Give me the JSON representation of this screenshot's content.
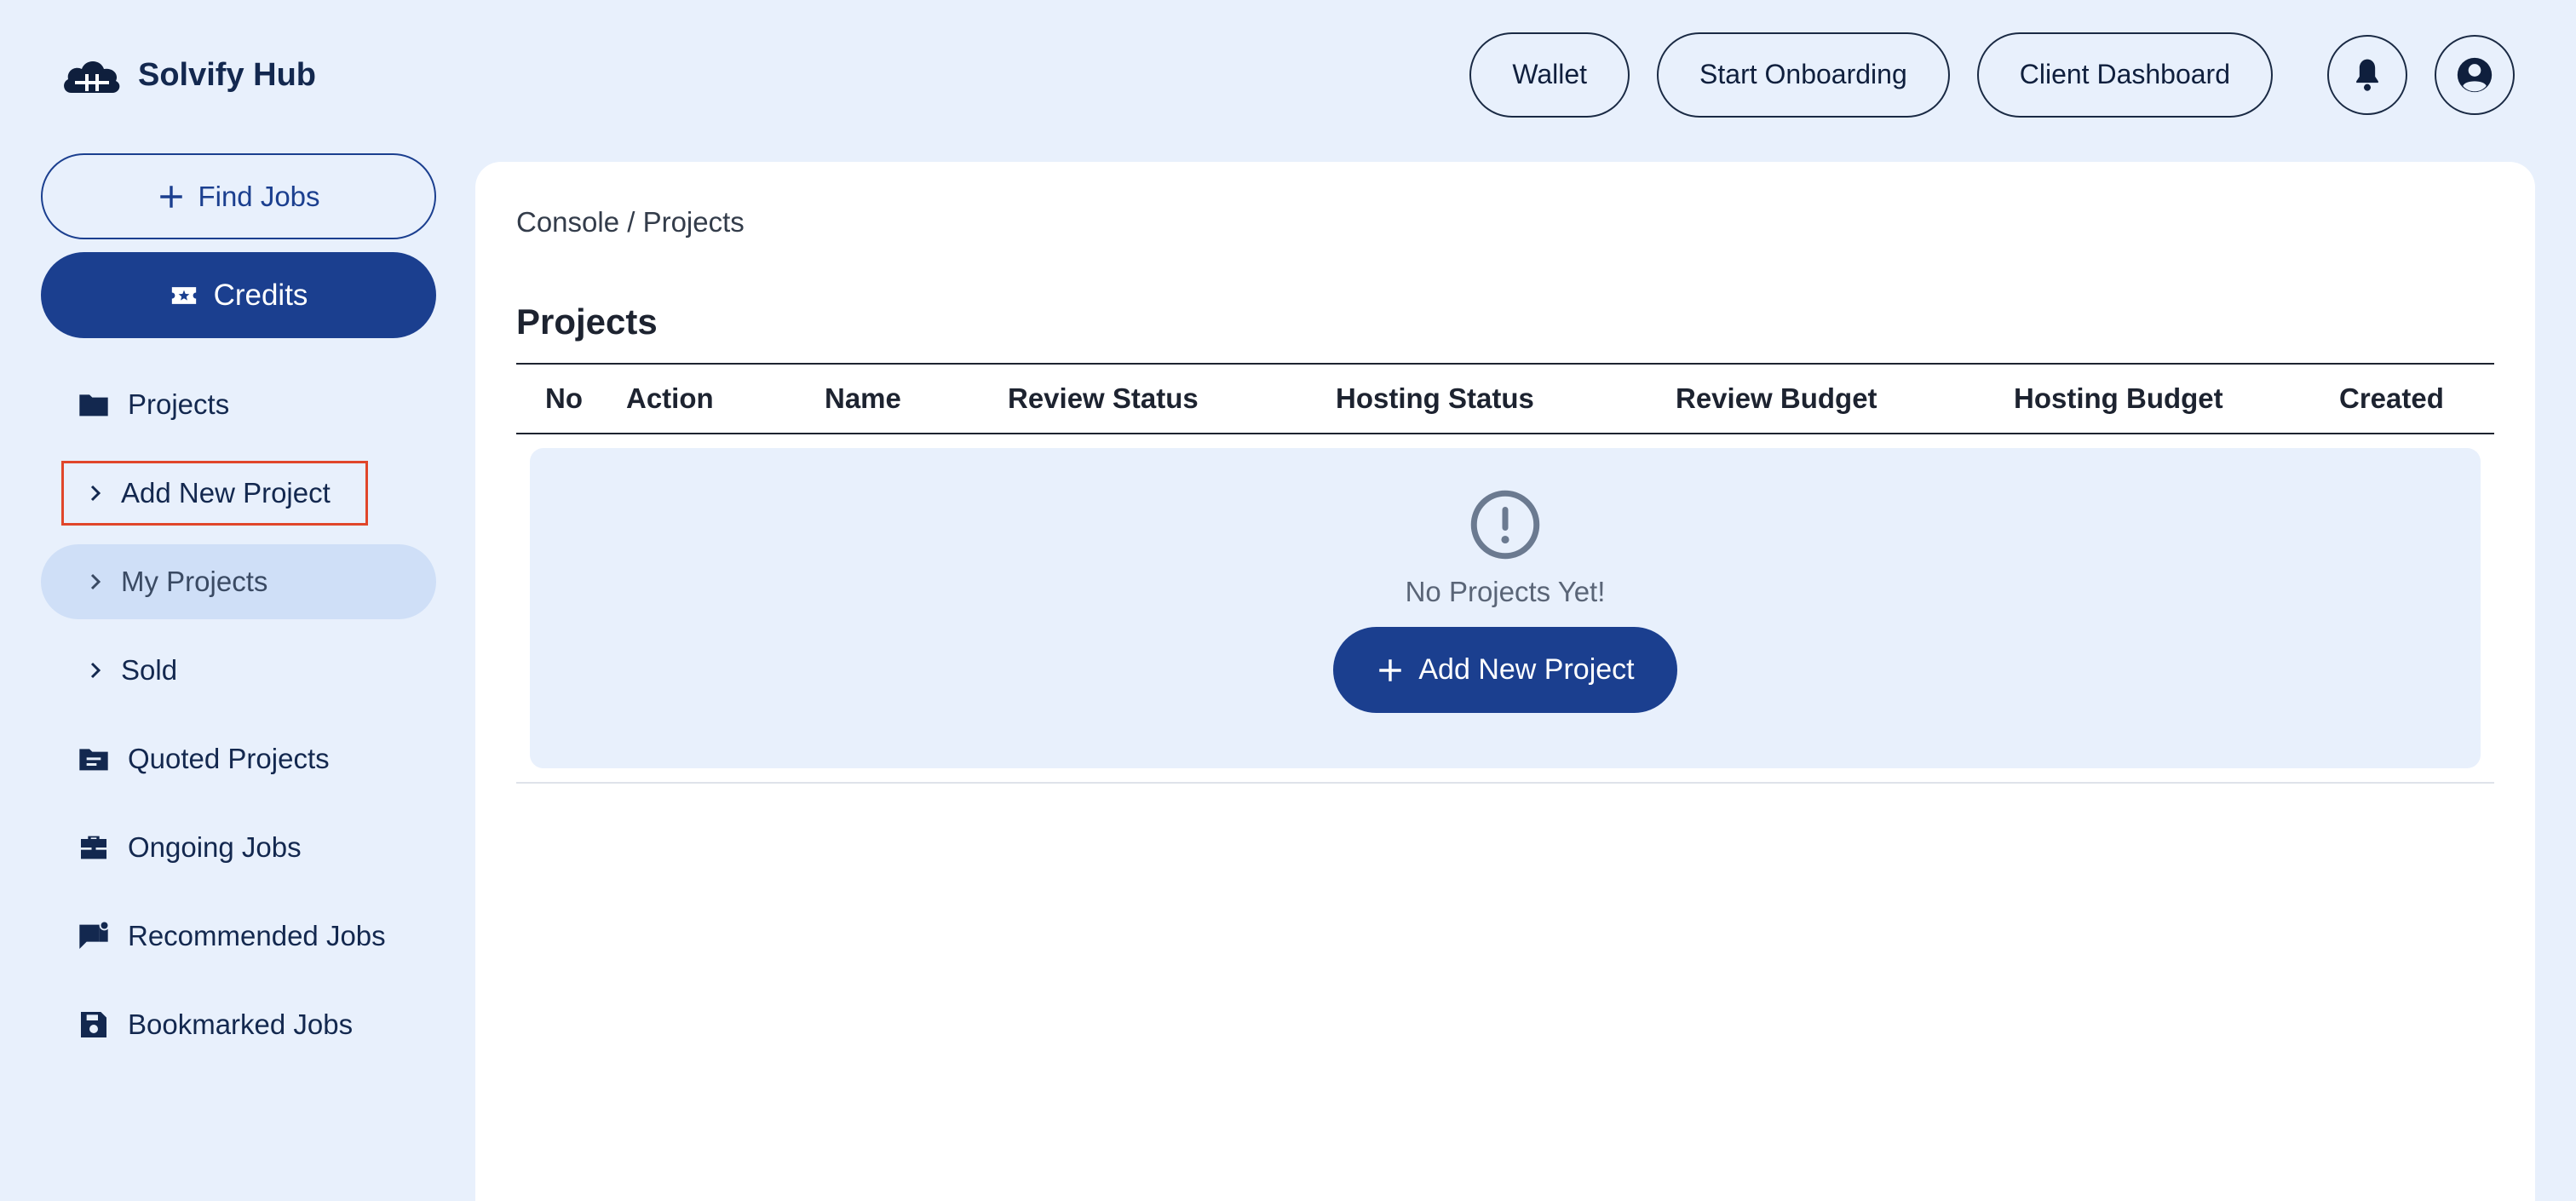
{
  "brand": {
    "name": "Solvify Hub",
    "icon": "cloud-icon"
  },
  "header": {
    "buttons": [
      "Wallet",
      "Start Onboarding",
      "Client Dashboard"
    ],
    "icons": [
      "bell-icon",
      "account-icon"
    ]
  },
  "sidebar": {
    "find_jobs": "Find Jobs",
    "credits": "Credits",
    "items": [
      {
        "label": "Projects",
        "icon": "folder-icon"
      },
      {
        "label": "Add New Project",
        "icon": "chevron-right-icon"
      },
      {
        "label": "My Projects",
        "icon": "chevron-right-icon"
      },
      {
        "label": "Sold",
        "icon": "chevron-right-icon"
      },
      {
        "label": "Quoted Projects",
        "icon": "folder-list-icon"
      },
      {
        "label": "Ongoing Jobs",
        "icon": "briefcase-icon"
      },
      {
        "label": "Recommended Jobs",
        "icon": "chat-notification-icon"
      },
      {
        "label": "Bookmarked Jobs",
        "icon": "save-icon"
      }
    ]
  },
  "main": {
    "breadcrumb": "Console / Projects",
    "title": "Projects",
    "columns": [
      "No",
      "Action",
      "Name",
      "Review Status",
      "Hosting Status",
      "Review Budget",
      "Hosting Budget",
      "Created"
    ],
    "empty_text": "No Projects Yet!",
    "add_button": "Add New Project"
  },
  "colors": {
    "primary": "#1b3f8f",
    "background": "#e8f0fc",
    "active_item": "#cfdff7",
    "highlight": "#e0462a"
  }
}
